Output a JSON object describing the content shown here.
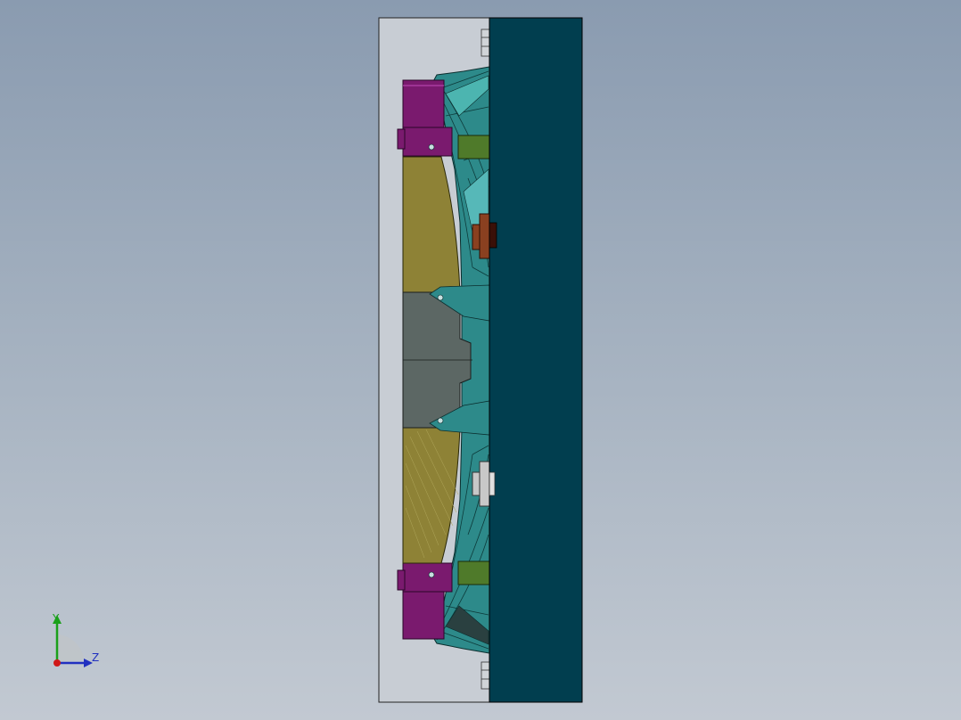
{
  "view": {
    "triad": {
      "y_label": "Y",
      "z_label": "Z"
    },
    "colors": {
      "background_top": "#8a9bb0",
      "background_bottom": "#c2c9d2",
      "plate": "#013e4f",
      "frame": "#c8cdd4",
      "teal_body": "#2d8a8a",
      "purple_block": "#7a1a6e",
      "olive_panel": "#8e8236",
      "gray_panel": "#5c6764",
      "green_block": "#4f7a2a",
      "rust_block": "#8a4020",
      "light_block": "#c8c8c8",
      "y_axis": "#1aa01a",
      "z_axis": "#2030c0",
      "x_axis": "#d01818"
    }
  }
}
